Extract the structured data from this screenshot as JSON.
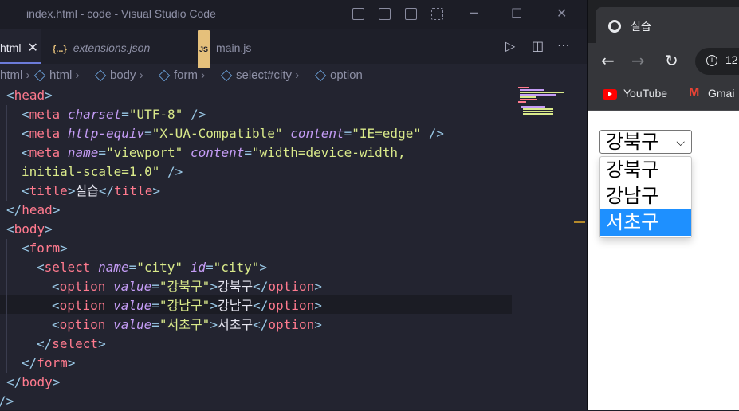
{
  "window": {
    "title": "index.html - code - Visual Studio Code"
  },
  "tabs": [
    {
      "label": "html",
      "close": "✕"
    },
    {
      "label": "extensions.json",
      "icon": "{...}"
    },
    {
      "label": "main.js",
      "icon": "JS"
    }
  ],
  "breadcrumb": [
    "html",
    "html",
    "body",
    "form",
    "select#city",
    "option"
  ],
  "editor": {
    "lines": [
      "<head>",
      "<meta charset=\"UTF-8\" />",
      "<meta http-equiv=\"X-UA-Compatible\" content=\"IE=edge\" />",
      "<meta name=\"viewport\" content=\"width=device-width,",
      "initial-scale=1.0\" />",
      "<title>실습</title>",
      "</head>",
      "<body>",
      "<form>",
      "<select name=\"city\" id=\"city\">",
      "<option value=\"강북구\">강북구</option>",
      "<option value=\"강남구\">강남구</option>",
      "<option value=\"서초구\">서초구</option>",
      "</select>",
      "</form>",
      "</body>",
      "</html>"
    ]
  },
  "browser": {
    "tab_title": "실습",
    "url": "12",
    "bookmarks": [
      {
        "label": "YouTube",
        "icon": "youtube-icon"
      },
      {
        "label": "Gmai",
        "icon": "gmail-icon"
      }
    ],
    "select": {
      "value": "강북구",
      "options": [
        "강북구",
        "강남구",
        "서초구"
      ],
      "highlighted": "서초구"
    }
  },
  "colors": {
    "editor_bg": "#232430",
    "tag": "#ff7a8e",
    "attr": "#c49cf5",
    "string": "#d9e98a",
    "option_highlight": "#1e90ff"
  }
}
